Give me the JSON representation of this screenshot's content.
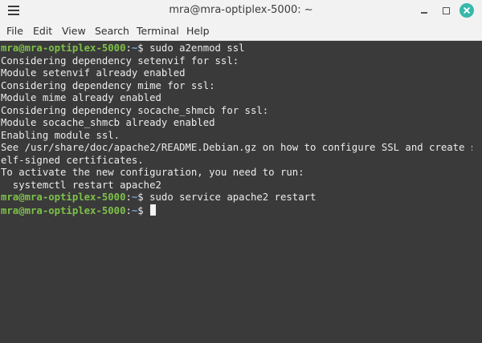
{
  "window": {
    "title": "mra@mra-optiplex-5000: ~"
  },
  "menu": [
    "File",
    "Edit",
    "View",
    "Search",
    "Terminal",
    "Help"
  ],
  "terminal": {
    "prompt_user_host": "mra@mra-optiplex-5000",
    "prompt_sep": ":",
    "prompt_path": "~",
    "prompt_symbol": "$ ",
    "command1": "sudo a2enmod ssl",
    "output": [
      "Considering dependency setenvif for ssl:",
      "Module setenvif already enabled",
      "Considering dependency mime for ssl:",
      "Module mime already enabled",
      "Considering dependency socache_shmcb for ssl:",
      "Module socache_shmcb already enabled",
      "Enabling module ssl.",
      "See /usr/share/doc/apache2/README.Debian.gz on how to configure SSL and create s",
      "elf-signed certificates.",
      "To activate the new configuration, you need to run:",
      "  systemctl restart apache2"
    ],
    "command2": "sudo service apache2 restart",
    "command3": ""
  },
  "colors": {
    "terminal_bg": "#3a3a3a",
    "prompt_green": "#7ec14a",
    "prompt_blue": "#7aa5d9",
    "close_button": "#35b9ab"
  },
  "icons": {
    "menu": "hamburger-menu-icon",
    "minimize": "minimize-icon",
    "maximize": "maximize-icon",
    "close": "close-icon"
  }
}
